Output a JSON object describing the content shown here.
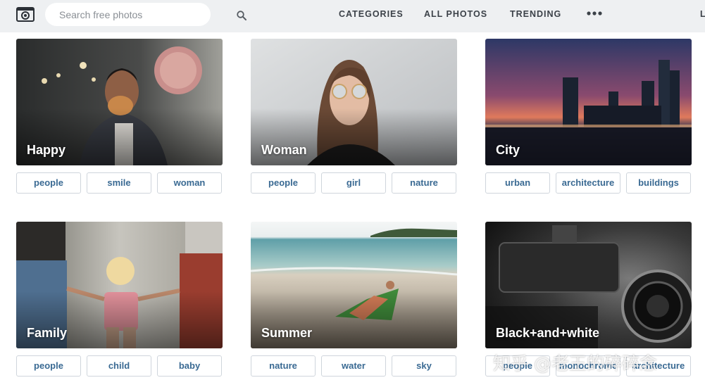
{
  "header": {
    "search_placeholder": "Search free photos",
    "nav": [
      "CATEGORIES",
      "ALL PHOTOS",
      "TRENDING"
    ],
    "more": "•••",
    "truncated_item": "L"
  },
  "cards": [
    {
      "title": "Happy",
      "tags": [
        "people",
        "smile",
        "woman"
      ]
    },
    {
      "title": "Woman",
      "tags": [
        "people",
        "girl",
        "nature"
      ]
    },
    {
      "title": "City",
      "tags": [
        "urban",
        "architecture",
        "buildings"
      ]
    },
    {
      "title": "Family",
      "tags": [
        "people",
        "child",
        "baby"
      ]
    },
    {
      "title": "Summer",
      "tags": [
        "nature",
        "water",
        "sky"
      ]
    },
    {
      "title": "Black+and+white",
      "tags": [
        "people",
        "monochrome",
        "architecture"
      ]
    }
  ],
  "watermark": "知乎 @老王的碎碎念",
  "colors": {
    "topbar": "#eef0f2",
    "tag_text": "#3a6a93",
    "tag_border": "#cfd5dc"
  }
}
